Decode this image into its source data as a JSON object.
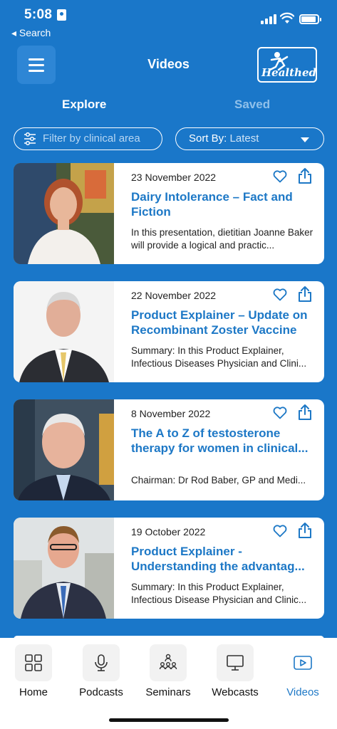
{
  "status_bar": {
    "time": "5:08",
    "back_label": "◂ Search"
  },
  "header": {
    "title": "Videos",
    "logo_text": "Healthed"
  },
  "tabs": [
    {
      "label": "Explore",
      "active": true
    },
    {
      "label": "Saved",
      "active": false
    }
  ],
  "filters": {
    "filter_placeholder": "Filter by clinical area",
    "sort_label": "Sort By:",
    "sort_value": "Latest"
  },
  "videos": [
    {
      "date": "23 November 2022",
      "title": "Dairy Intolerance – Fact and Fiction",
      "summary": "In this presentation, dietitian Joanne Baker will provide a logical and practic...",
      "thumb_icon": "presenter-woman-photo"
    },
    {
      "date": "22 November 2022",
      "title": "Product Explainer – Update on Recombinant Zoster Vaccine",
      "summary": "Summary: In this Product Explainer, Infectious Diseases Physician and Clini...",
      "thumb_icon": "presenter-man-photo"
    },
    {
      "date": "8 November 2022",
      "title": "The A to Z of testosterone therapy for women in clinical...",
      "summary": "Chairman: Dr Rod Baber, GP and Medi...",
      "thumb_icon": "presenter-man-photo"
    },
    {
      "date": "19 October 2022",
      "title": "Product Explainer - Understanding the advantag...",
      "summary": "Summary: In this Product Explainer, Infectious Disease Physician and Clinic...",
      "thumb_icon": "presenter-man-photo"
    }
  ],
  "bottom_nav": [
    {
      "label": "Home",
      "icon": "grid-icon",
      "active": false
    },
    {
      "label": "Podcasts",
      "icon": "microphone-icon",
      "active": false
    },
    {
      "label": "Seminars",
      "icon": "people-hierarchy-icon",
      "active": false
    },
    {
      "label": "Webcasts",
      "icon": "monitor-icon",
      "active": false
    },
    {
      "label": "Videos",
      "icon": "play-icon",
      "active": true
    }
  ],
  "colors": {
    "background": "#1a77c9",
    "accent": "#1d78c6",
    "inactive_tab": "#8fc0ea"
  }
}
